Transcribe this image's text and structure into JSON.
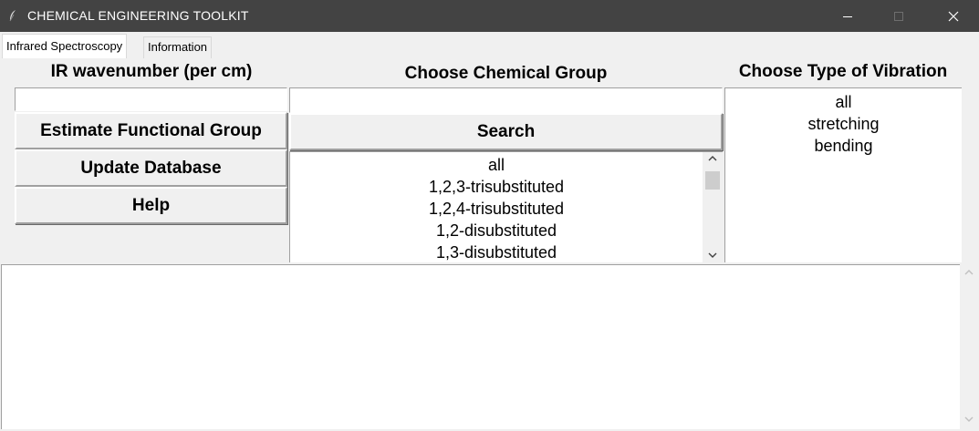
{
  "window": {
    "title": "CHEMICAL ENGINEERING TOOLKIT",
    "titlebar_color": "#434343",
    "app_icon": "feather-icon",
    "controls": [
      "minimize-icon",
      "maximize-icon",
      "close-icon"
    ]
  },
  "tabs": [
    {
      "label": "Infrared Spectroscopy",
      "active": true
    },
    {
      "label": "Information",
      "active": false
    }
  ],
  "left": {
    "wavenumber_label": "IR wavenumber (per cm)",
    "wavenumber_value": "",
    "buttons": [
      {
        "label": "Estimate Functional Group"
      },
      {
        "label": "Update Database"
      },
      {
        "label": "Help"
      }
    ]
  },
  "middle": {
    "group_label": "Choose Chemical Group",
    "group_value": "",
    "search_label": "Search",
    "groups": [
      "all",
      "1,2,3-trisubstituted",
      "1,2,4-trisubstituted",
      "1,2-disubstituted",
      "1,3-disubstituted"
    ]
  },
  "right": {
    "vibration_label": "Choose Type of Vibration",
    "vibrations": [
      "all",
      "stretching",
      "bending"
    ]
  },
  "output": {
    "text": ""
  }
}
